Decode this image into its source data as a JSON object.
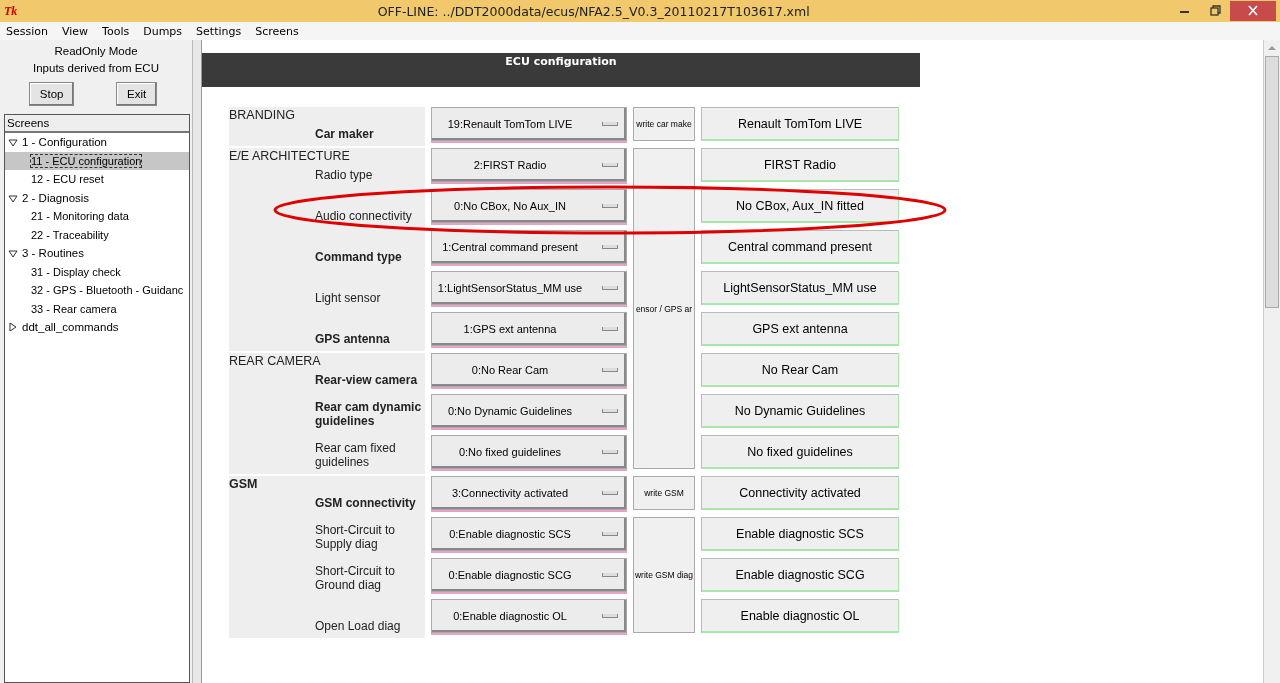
{
  "window": {
    "logo": "Tk",
    "title": "OFF-LINE: ../DDT2000data/ecus/NFA2.5_V0.3_20110217T103617.xml"
  },
  "menu": [
    "Session",
    "View",
    "Tools",
    "Dumps",
    "Settings",
    "Screens"
  ],
  "side": {
    "mode": "ReadOnly Mode",
    "inputs": "Inputs derived from ECU",
    "buttons": [
      "Stop",
      "Exit"
    ],
    "tree_title": "Screens",
    "tree": [
      {
        "label": "1 - Configuration",
        "expanded": true,
        "selected": false,
        "children": [
          {
            "label": "11 - ECU configuration",
            "selected": true
          },
          {
            "label": "12 - ECU reset",
            "selected": false
          }
        ]
      },
      {
        "label": "2 - Diagnosis",
        "expanded": true,
        "selected": false,
        "children": [
          {
            "label": "21 - Monitoring data",
            "selected": false
          },
          {
            "label": "22 - Traceability",
            "selected": false
          }
        ]
      },
      {
        "label": "3 - Routines",
        "expanded": true,
        "selected": false,
        "children": [
          {
            "label": "31 - Display check",
            "selected": false
          },
          {
            "label": "32 - GPS - Bluetooth - Guidanc",
            "selected": false
          },
          {
            "label": "33 - Rear camera",
            "selected": false
          }
        ]
      },
      {
        "label": "ddt_all_commands",
        "expanded": false,
        "selected": false
      }
    ]
  },
  "screen": {
    "title": "ECU configuration",
    "sections": [
      {
        "title": "BRANDING",
        "bold": false,
        "rows": [
          {
            "label": "Car maker",
            "bold": true,
            "value": "19:Renault TomTom LIVE",
            "result": "Renault TomTom LIVE",
            "write": "write car make"
          }
        ]
      },
      {
        "title": "E/E ARCHITECTURE",
        "bold": false,
        "rows": [
          {
            "label": "Radio type",
            "bold": false,
            "value": "2:FIRST Radio",
            "result": "FIRST Radio",
            "write": "ensor / GPS ar"
          },
          {
            "label": "Audio connectivity",
            "bold": false,
            "value": "0:No CBox, No Aux_IN",
            "result": "No CBox, Aux_IN fitted"
          },
          {
            "label": "Command type",
            "bold": true,
            "value": "1:Central command present",
            "result": "Central command present"
          },
          {
            "label": "Light sensor",
            "bold": false,
            "value": "1:LightSensorStatus_MM use",
            "result": "LightSensorStatus_MM use"
          },
          {
            "label": "GPS antenna",
            "bold": true,
            "value": "1:GPS ext antenna",
            "result": "GPS ext antenna"
          }
        ]
      },
      {
        "title": "REAR CAMERA",
        "bold": false,
        "rows": [
          {
            "label": "Rear-view camera",
            "bold": true,
            "value": "0:No Rear Cam",
            "result": "No Rear Cam"
          },
          {
            "label": "Rear cam dynamic guidelines",
            "bold": true,
            "value": "0:No Dynamic Guidelines",
            "result": "No Dynamic Guidelines"
          },
          {
            "label": "Rear cam fixed guidelines",
            "bold": false,
            "value": "0:No fixed guidelines",
            "result": "No fixed guidelines"
          }
        ]
      },
      {
        "title": "GSM",
        "bold": true,
        "rows": [
          {
            "label": "GSM connectivity",
            "bold": true,
            "value": "3:Connectivity activated",
            "result": "Connectivity activated",
            "write": "write GSM"
          },
          {
            "label": "Short-Circuit to Supply diag",
            "bold": false,
            "value": "0:Enable diagnostic SCS",
            "result": "Enable diagnostic SCS",
            "write": "write GSM diag"
          },
          {
            "label": "Short-Circuit to Ground diag",
            "bold": false,
            "value": "0:Enable diagnostic SCG",
            "result": "Enable diagnostic SCG"
          },
          {
            "label": "Open Load diag",
            "bold": false,
            "value": "0:Enable diagnostic OL",
            "result": "Enable diagnostic OL"
          }
        ]
      }
    ]
  }
}
